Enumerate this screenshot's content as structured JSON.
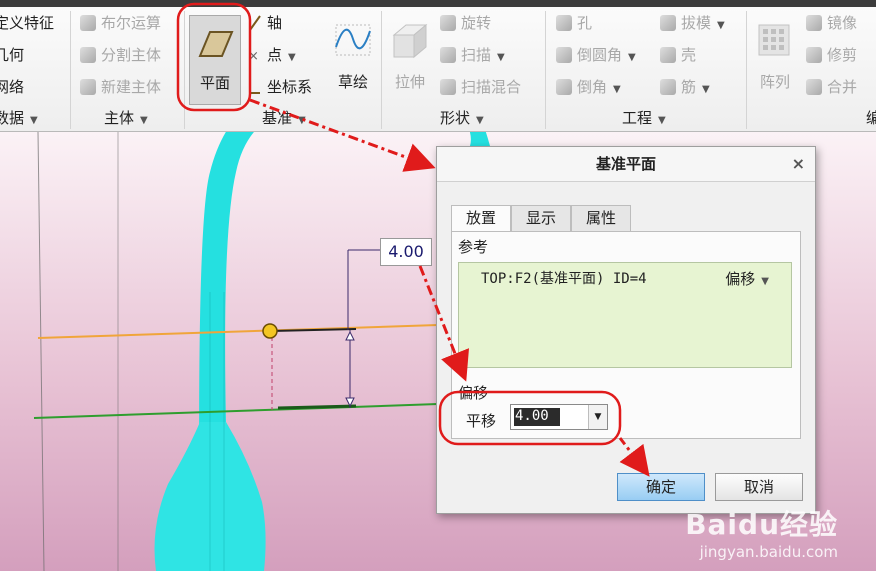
{
  "ribbon": {
    "col1": [
      "定义特征",
      "几何",
      "网络"
    ],
    "col1_group": "数据",
    "col2": [
      "布尔运算",
      "分割主体",
      "新建主体"
    ],
    "col2_group": "主体",
    "plane": "平面",
    "datum_items": [
      "轴",
      "点",
      "坐标系"
    ],
    "sketch": "草绘",
    "datum_group": "基准",
    "extrude": "拉伸",
    "shape_items": [
      "旋转",
      "扫描",
      "扫描混合"
    ],
    "shape_group": "形状",
    "eng_col1": [
      "孔",
      "倒圆角",
      "倒角"
    ],
    "eng_col2": [
      "拔模",
      "壳",
      "筋"
    ],
    "eng_group": "工程",
    "pattern": "阵列",
    "edit_items": [
      "镜像",
      "修剪",
      "合并"
    ],
    "edit_group_partial": "编"
  },
  "viewport": {
    "dimension_value": "4.00"
  },
  "dialog": {
    "title": "基准平面",
    "close": "×",
    "tabs": [
      "放置",
      "显示",
      "属性"
    ],
    "reference_label": "参考",
    "reference_item": "TOP:F2(基准平面) ID=4",
    "reference_type": "偏移",
    "offset_label": "偏移",
    "translate_label": "平移",
    "offset_value": "4.00",
    "ok": "确定",
    "cancel": "取消"
  },
  "watermark": {
    "brand": "Baidu经验",
    "url": "jingyan.baidu.com"
  },
  "colors": {
    "part": "#25e0e0",
    "annotation": "#e01b1b",
    "ok_button": "#98cdf3",
    "reference_bg": "#e7f4d2"
  }
}
